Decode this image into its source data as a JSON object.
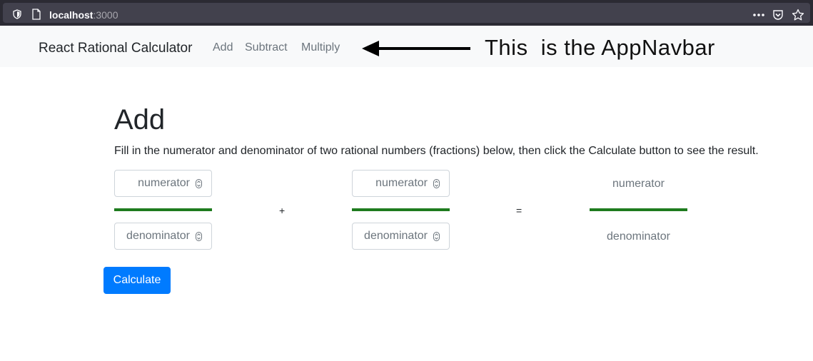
{
  "browser": {
    "url_host": "localhost",
    "url_port": ":3000"
  },
  "navbar": {
    "brand": "React Rational Calculator",
    "links": [
      {
        "label": "Add"
      },
      {
        "label": "Subtract"
      },
      {
        "label": "Multiply"
      }
    ],
    "annotation": "This  is the AppNavbar"
  },
  "main": {
    "title": "Add",
    "instructions": "Fill in the numerator and denominator of two rational numbers (fractions) below, then click the Calculate button to see the result.",
    "operand1": {
      "numerator_placeholder": "numerator",
      "denominator_placeholder": "denominator"
    },
    "operator": "+",
    "operand2": {
      "numerator_placeholder": "numerator",
      "denominator_placeholder": "denominator"
    },
    "equals": "=",
    "result": {
      "numerator": "numerator",
      "denominator": "denominator"
    },
    "calculate_label": "Calculate"
  },
  "colors": {
    "fraction_bar": "#1e7b1e",
    "primary_button": "#007bff",
    "navbar_bg": "#f8f9fa"
  }
}
